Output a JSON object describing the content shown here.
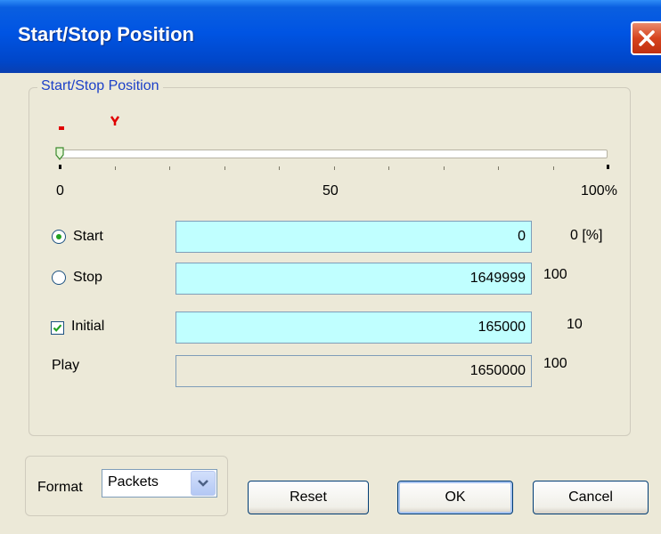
{
  "window": {
    "title": "Start/Stop Position"
  },
  "group": {
    "legend": "Start/Stop Position"
  },
  "slider": {
    "start_percent": 0,
    "initial_percent": 10,
    "axis_labels": [
      "0",
      "50",
      "100%"
    ],
    "marker_color": "#e00000"
  },
  "rows": {
    "start": {
      "label": "Start",
      "value": "0",
      "percent": "0 [%]",
      "selected": true
    },
    "stop": {
      "label": "Stop",
      "value": "1649999",
      "percent": "100",
      "selected": false
    },
    "initial": {
      "label": "Initial",
      "value": "165000",
      "percent": "10",
      "checked": true
    },
    "play": {
      "label": "Play",
      "value": "1650000",
      "percent": "100"
    }
  },
  "format": {
    "label": "Format",
    "selected": "Packets"
  },
  "buttons": {
    "reset": "Reset",
    "ok": "OK",
    "cancel": "Cancel"
  },
  "colors": {
    "field_bg": "#c0ffff",
    "titlebar": "#0054e3",
    "accent_text": "#1c40c8"
  }
}
